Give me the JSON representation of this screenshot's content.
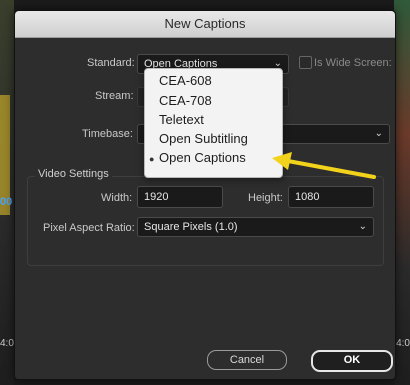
{
  "dialog": {
    "title": "New Captions",
    "standard": {
      "label": "Standard:",
      "value": "Open Captions"
    },
    "wide_screen": {
      "label": "Is Wide Screen:"
    },
    "stream": {
      "label": "Stream:"
    },
    "timebase": {
      "label": "Timebase:"
    },
    "video_settings": {
      "heading": "Video Settings",
      "width": {
        "label": "Width:",
        "value": "1920"
      },
      "height": {
        "label": "Height:",
        "value": "1080"
      },
      "par": {
        "label": "Pixel Aspect Ratio:",
        "value": "Square Pixels (1.0)"
      }
    },
    "buttons": {
      "cancel": "Cancel",
      "ok": "OK"
    }
  },
  "dropdown": {
    "options": [
      "CEA-608",
      "CEA-708",
      "Teletext",
      "Open Subtitling",
      "Open Captions"
    ],
    "selected_index": 4
  },
  "background": {
    "left_number": "00",
    "left_timecode": "4:0",
    "right_timecode": "4:0"
  },
  "colors": {
    "annotation_arrow": "#f2d21b"
  },
  "icons": [
    "chevron-down-icon",
    "bullet-icon",
    "arrow-annotation-icon"
  ]
}
